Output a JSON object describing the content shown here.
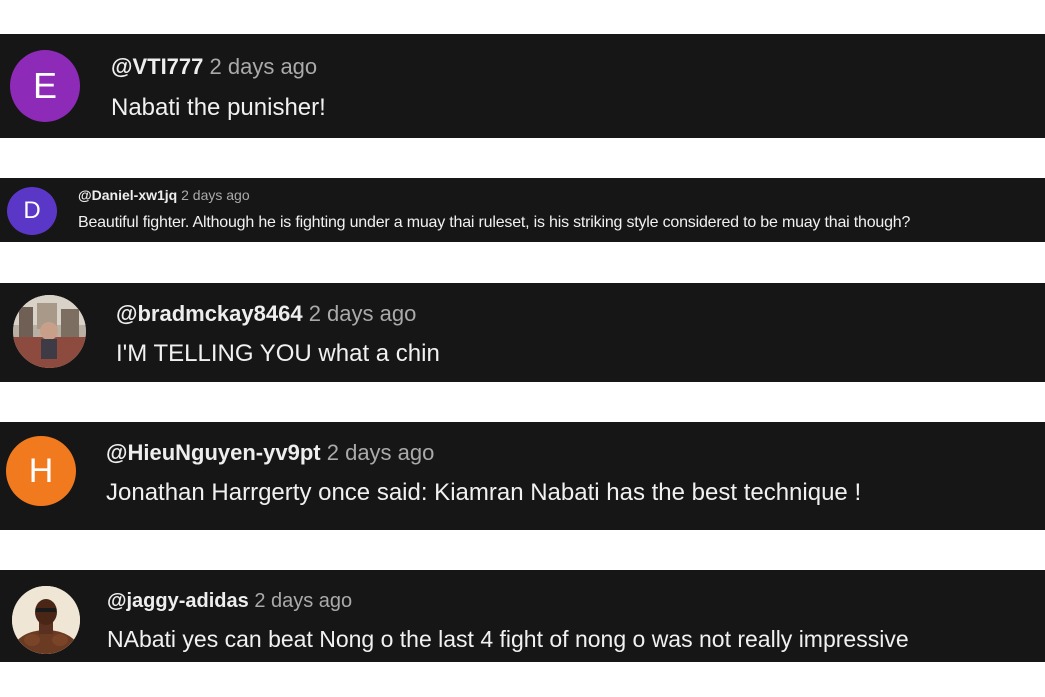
{
  "colors": {
    "page_bg": "#ffffff",
    "card_bg": "#161616",
    "handle": "#eeeeee",
    "time": "#aaaaaa",
    "text": "#f1f1f1",
    "avatar_e": "#8e2ab8",
    "avatar_d": "#5a37c6",
    "avatar_h": "#f27a1e"
  },
  "comments": [
    {
      "handle": "@VTI777",
      "time": "2 days ago",
      "text": "Nabati the punisher!",
      "avatar_letter": "E",
      "avatar_type": "letter"
    },
    {
      "handle": "@Daniel-xw1jq",
      "time": "2 days ago",
      "text": "Beautiful fighter. Although he is fighting under a muay thai ruleset, is his striking style considered to be muay thai though?",
      "avatar_letter": "D",
      "avatar_type": "letter"
    },
    {
      "handle": "@bradmckay8464",
      "time": "2 days ago",
      "text": "I'M TELLING YOU  what a chin",
      "avatar_type": "photo"
    },
    {
      "handle": "@HieuNguyen-yv9pt",
      "time": "2 days ago",
      "text": "Jonathan Harrgerty once said: Kiamran Nabati has the best technique !",
      "avatar_letter": "H",
      "avatar_type": "letter"
    },
    {
      "handle": "@jaggy-adidas",
      "time": "2 days ago",
      "text": "NAbati  yes can beat Nong o the last 4 fight of nong o was not really impressive",
      "avatar_type": "photo"
    }
  ]
}
